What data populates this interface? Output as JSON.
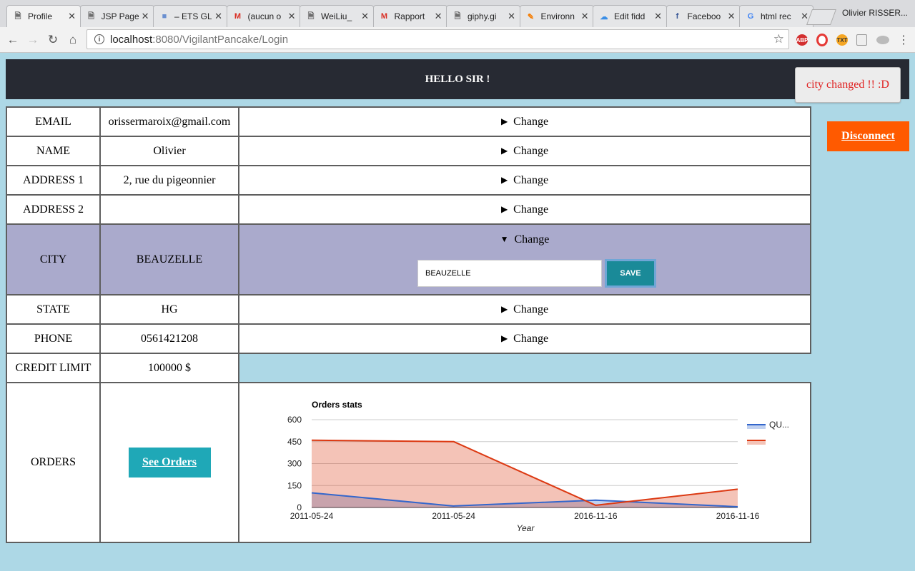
{
  "browser": {
    "tabs": [
      {
        "label": "Profile",
        "icon": "page-icon",
        "active": true
      },
      {
        "label": "JSP Page",
        "icon": "page-icon"
      },
      {
        "label": "– ETS GL",
        "icon": "site-icon"
      },
      {
        "label": "(aucun o",
        "icon": "gmail-icon"
      },
      {
        "label": "WeiLiu_",
        "icon": "page-icon"
      },
      {
        "label": "Rapport",
        "icon": "gmail-icon"
      },
      {
        "label": "giphy.gi",
        "icon": "page-icon"
      },
      {
        "label": "Environn",
        "icon": "pencil-icon"
      },
      {
        "label": "Edit fidd",
        "icon": "cloud-icon"
      },
      {
        "label": "Faceboo",
        "icon": "facebook-icon"
      },
      {
        "label": "html rec",
        "icon": "google-icon"
      }
    ],
    "profile_name": "Olivier RISSER...",
    "url_host": "localhost",
    "url_path": ":8080/VigilantPancake/Login"
  },
  "page": {
    "greeting": "HELLO SIR !",
    "toast": "city changed !! :D",
    "disconnect_label": "Disconnect",
    "change_label": "Change",
    "rows": {
      "email": {
        "label": "EMAIL",
        "value": "orissermaroix@gmail.com"
      },
      "name": {
        "label": "NAME",
        "value": "Olivier"
      },
      "address1": {
        "label": "ADDRESS 1",
        "value": "2, rue du pigeonnier"
      },
      "address2": {
        "label": "ADDRESS 2",
        "value": ""
      },
      "city": {
        "label": "CITY",
        "value": "BEAUZELLE",
        "input_value": "BEAUZELLE",
        "save_label": "SAVE"
      },
      "state": {
        "label": "STATE",
        "value": "HG"
      },
      "phone": {
        "label": "PHONE",
        "value": "0561421208"
      },
      "credit": {
        "label": "CREDIT LIMIT",
        "value": "100000 $"
      },
      "orders": {
        "label": "ORDERS",
        "button_label": "See Orders"
      }
    }
  },
  "chart_data": {
    "type": "area",
    "title": "Orders stats",
    "xlabel": "Year",
    "ylabel": "",
    "x": [
      "2011-05-24",
      "2011-05-24",
      "2016-11-16",
      "2016-11-16"
    ],
    "ylim": [
      0,
      600
    ],
    "yticks": [
      0,
      150,
      300,
      450,
      600
    ],
    "grid": true,
    "legend_position": "right",
    "series": [
      {
        "name": "QU...",
        "values": [
          100,
          10,
          50,
          5
        ],
        "color": "#3366cc"
      },
      {
        "values": [
          460,
          450,
          15,
          125
        ],
        "color": "#dc3912"
      }
    ]
  }
}
